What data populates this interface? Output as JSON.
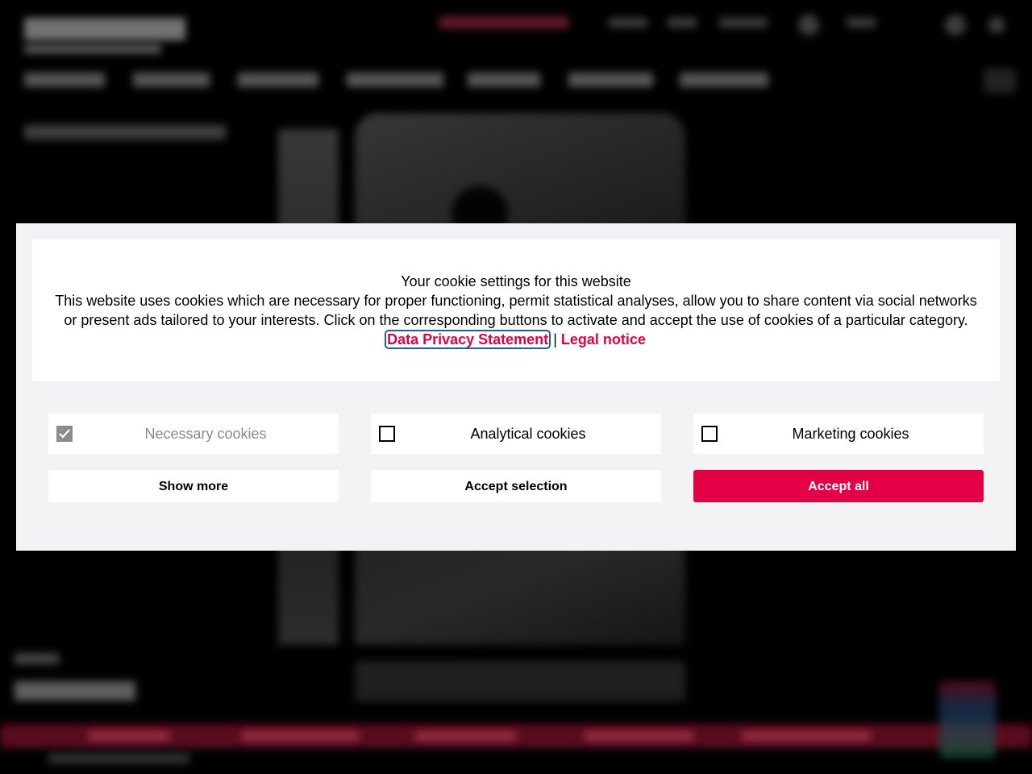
{
  "cookie_banner": {
    "title": "Your cookie settings for this website",
    "description": "This website uses cookies which are necessary for proper functioning, permit statistical analyses, allow you to share content via social networks or present ads tailored to your interests. Click on the corresponding buttons to activate and accept the use of cookies of a particular category.",
    "privacy_link": "Data Privacy Statement",
    "separator": "|",
    "legal_link": "Legal notice",
    "options": [
      {
        "label": "Necessary cookies",
        "checked": true,
        "disabled": true
      },
      {
        "label": "Analytical cookies",
        "checked": false,
        "disabled": false
      },
      {
        "label": "Marketing cookies",
        "checked": false,
        "disabled": false
      }
    ],
    "buttons": {
      "show_more": "Show more",
      "accept_selection": "Accept selection",
      "accept_all": "Accept all"
    },
    "colors": {
      "accent": "#e40046",
      "panel_background": "#f3f3f5",
      "focus_outline": "#1a5fb4",
      "disabled_checkbox": "#8c8c8c"
    }
  },
  "icons": {
    "checkmark": "check-icon"
  }
}
